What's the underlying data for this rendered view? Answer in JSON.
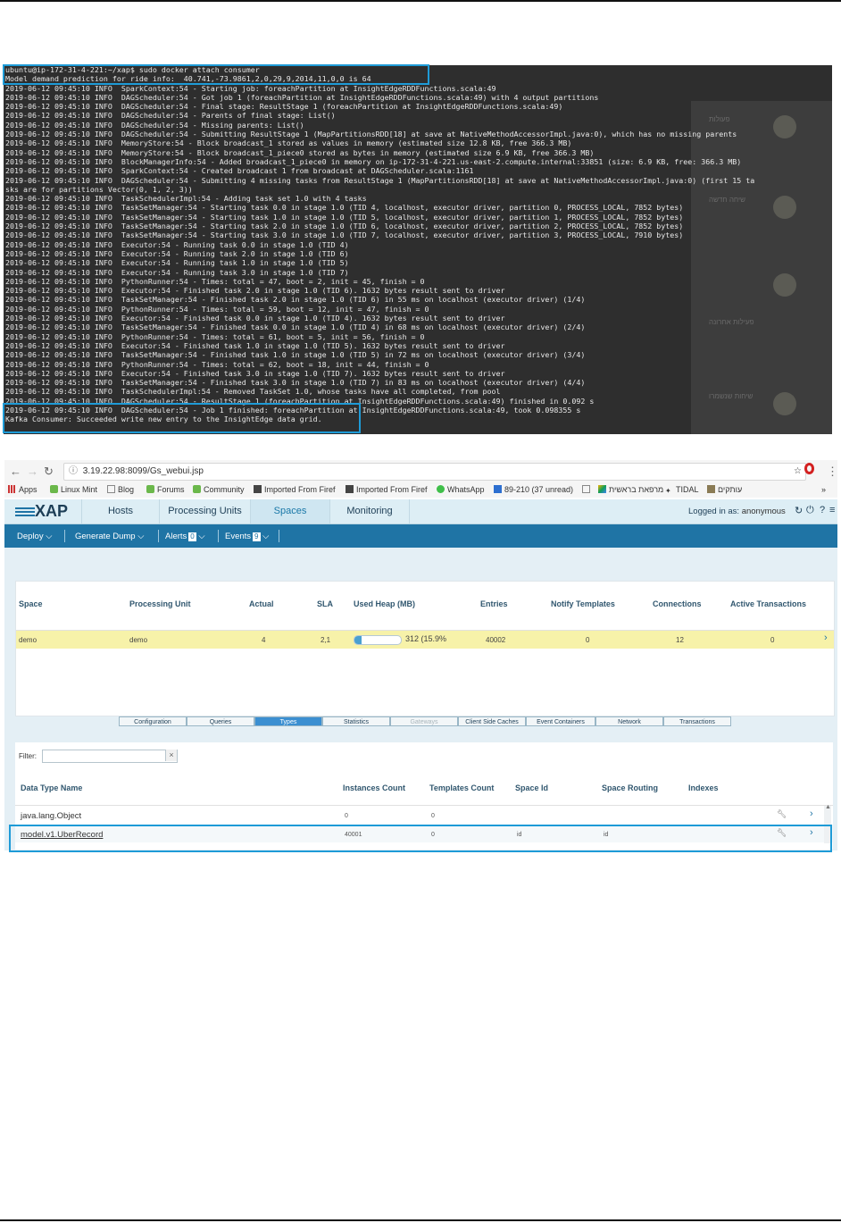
{
  "terminal": {
    "lines": [
      "ubuntu@ip-172-31-4-221:~/xap$ sudo docker attach consumer",
      "Model demand prediction for ride info:  40.741,-73.9861,2,0,29,9,2014,11,0,0 is 64",
      "2019-06-12 09:45:10 INFO  SparkContext:54 - Starting job: foreachPartition at InsightEdgeRDDFunctions.scala:49",
      "2019-06-12 09:45:10 INFO  DAGScheduler:54 - Got job 1 (foreachPartition at InsightEdgeRDDFunctions.scala:49) with 4 output partitions",
      "2019-06-12 09:45:10 INFO  DAGScheduler:54 - Final stage: ResultStage 1 (foreachPartition at InsightEdgeRDDFunctions.scala:49)",
      "2019-06-12 09:45:10 INFO  DAGScheduler:54 - Parents of final stage: List()",
      "2019-06-12 09:45:10 INFO  DAGScheduler:54 - Missing parents: List()",
      "2019-06-12 09:45:10 INFO  DAGScheduler:54 - Submitting ResultStage 1 (MapPartitionsRDD[18] at save at NativeMethodAccessorImpl.java:0), which has no missing parents",
      "2019-06-12 09:45:10 INFO  MemoryStore:54 - Block broadcast_1 stored as values in memory (estimated size 12.8 KB, free 366.3 MB)",
      "2019-06-12 09:45:10 INFO  MemoryStore:54 - Block broadcast_1_piece0 stored as bytes in memory (estimated size 6.9 KB, free 366.3 MB)",
      "2019-06-12 09:45:10 INFO  BlockManagerInfo:54 - Added broadcast_1_piece0 in memory on ip-172-31-4-221.us-east-2.compute.internal:33851 (size: 6.9 KB, free: 366.3 MB)",
      "2019-06-12 09:45:10 INFO  SparkContext:54 - Created broadcast 1 from broadcast at DAGScheduler.scala:1161",
      "2019-06-12 09:45:10 INFO  DAGScheduler:54 - Submitting 4 missing tasks from ResultStage 1 (MapPartitionsRDD[18] at save at NativeMethodAccessorImpl.java:0) (first 15 ta",
      "sks are for partitions Vector(0, 1, 2, 3))",
      "2019-06-12 09:45:10 INFO  TaskSchedulerImpl:54 - Adding task set 1.0 with 4 tasks",
      "2019-06-12 09:45:10 INFO  TaskSetManager:54 - Starting task 0.0 in stage 1.0 (TID 4, localhost, executor driver, partition 0, PROCESS_LOCAL, 7852 bytes)",
      "2019-06-12 09:45:10 INFO  TaskSetManager:54 - Starting task 1.0 in stage 1.0 (TID 5, localhost, executor driver, partition 1, PROCESS_LOCAL, 7852 bytes)",
      "2019-06-12 09:45:10 INFO  TaskSetManager:54 - Starting task 2.0 in stage 1.0 (TID 6, localhost, executor driver, partition 2, PROCESS_LOCAL, 7852 bytes)",
      "2019-06-12 09:45:10 INFO  TaskSetManager:54 - Starting task 3.0 in stage 1.0 (TID 7, localhost, executor driver, partition 3, PROCESS_LOCAL, 7910 bytes)",
      "2019-06-12 09:45:10 INFO  Executor:54 - Running task 0.0 in stage 1.0 (TID 4)",
      "2019-06-12 09:45:10 INFO  Executor:54 - Running task 2.0 in stage 1.0 (TID 6)",
      "2019-06-12 09:45:10 INFO  Executor:54 - Running task 1.0 in stage 1.0 (TID 5)",
      "2019-06-12 09:45:10 INFO  Executor:54 - Running task 3.0 in stage 1.0 (TID 7)",
      "2019-06-12 09:45:10 INFO  PythonRunner:54 - Times: total = 47, boot = 2, init = 45, finish = 0",
      "2019-06-12 09:45:10 INFO  Executor:54 - Finished task 2.0 in stage 1.0 (TID 6). 1632 bytes result sent to driver",
      "2019-06-12 09:45:10 INFO  TaskSetManager:54 - Finished task 2.0 in stage 1.0 (TID 6) in 55 ms on localhost (executor driver) (1/4)",
      "2019-06-12 09:45:10 INFO  PythonRunner:54 - Times: total = 59, boot = 12, init = 47, finish = 0",
      "2019-06-12 09:45:10 INFO  Executor:54 - Finished task 0.0 in stage 1.0 (TID 4). 1632 bytes result sent to driver",
      "2019-06-12 09:45:10 INFO  TaskSetManager:54 - Finished task 0.0 in stage 1.0 (TID 4) in 68 ms on localhost (executor driver) (2/4)",
      "2019-06-12 09:45:10 INFO  PythonRunner:54 - Times: total = 61, boot = 5, init = 56, finish = 0",
      "2019-06-12 09:45:10 INFO  Executor:54 - Finished task 1.0 in stage 1.0 (TID 5). 1632 bytes result sent to driver",
      "2019-06-12 09:45:10 INFO  TaskSetManager:54 - Finished task 1.0 in stage 1.0 (TID 5) in 72 ms on localhost (executor driver) (3/4)",
      "2019-06-12 09:45:10 INFO  PythonRunner:54 - Times: total = 62, boot = 18, init = 44, finish = 0",
      "2019-06-12 09:45:10 INFO  Executor:54 - Finished task 3.0 in stage 1.0 (TID 7). 1632 bytes result sent to driver",
      "2019-06-12 09:45:10 INFO  TaskSetManager:54 - Finished task 3.0 in stage 1.0 (TID 7) in 83 ms on localhost (executor driver) (4/4)",
      "2019-06-12 09:45:10 INFO  TaskSchedulerImpl:54 - Removed TaskSet 1.0, whose tasks have all completed, from pool",
      "2019-06-12 09:45:10 INFO  DAGScheduler:54 - ResultStage 1 (foreachPartition at InsightEdgeRDDFunctions.scala:49) finished in 0.092 s",
      "2019-06-12 09:45:10 INFO  DAGScheduler:54 - Job 1 finished: foreachPartition at InsightEdgeRDDFunctions.scala:49, took 0.098355 s",
      "Kafka Consumer: Succeeded write new entry to the InsightEdge data grid."
    ],
    "background_notifications": [
      "פעולות",
      "שיחה חדשה",
      "פעילות אחרונה",
      "שיחות שנשמרו"
    ]
  },
  "browser": {
    "url": "3.19.22.98:8099/Gs_webui.jsp",
    "bookmarks": [
      "Apps",
      "Linux Mint",
      "Blog",
      "Forums",
      "Community",
      "Imported From Firef",
      "Imported From Firef",
      "WhatsApp",
      "89-210 (37 unread)",
      "מרפאת בראשית",
      "TIDAL",
      "עותקים"
    ],
    "more_bookmarks": "»"
  },
  "xap": {
    "logo": "XAP",
    "tabs": [
      "Hosts",
      "Processing Units",
      "Spaces",
      "Monitoring"
    ],
    "active_tab": "Spaces",
    "logged_in_label": "Logged in as:",
    "logged_in_user": "anonymous",
    "toolbar": {
      "deploy": "Deploy",
      "generate_dump": "Generate Dump",
      "alerts": "Alerts",
      "alerts_count": "0",
      "events": "Events",
      "events_count": "9"
    },
    "spaces_table": {
      "headers": [
        "Space",
        "Processing Unit",
        "Actual",
        "SLA",
        "Used Heap (MB)",
        "Entries",
        "Notify Templates",
        "Connections",
        "Active Transactions"
      ],
      "rows": [
        {
          "space": "demo",
          "processing_unit": "demo",
          "actual": "4",
          "sla": "2,1",
          "heap": "312 (15.9%",
          "heap_fraction": 0.159,
          "entries": "40002",
          "notify_templates": "0",
          "connections": "12",
          "active_transactions": "0"
        }
      ]
    },
    "detail_tabs": [
      "Configuration",
      "Queries",
      "Types",
      "Statistics",
      "Gateways",
      "Client Side Caches",
      "Event Containers",
      "Network",
      "Transactions"
    ],
    "active_detail_tab": "Types",
    "filter_label": "Filter:",
    "types_table": {
      "headers": [
        "Data Type Name",
        "Instances Count",
        "Templates Count",
        "Space Id",
        "Space Routing",
        "Indexes"
      ],
      "rows": [
        {
          "name": "java.lang.Object",
          "instances": "0",
          "templates": "0",
          "space_id": "",
          "space_routing": ""
        },
        {
          "name": "model.v1.UberRecord",
          "instances": "40001",
          "templates": "0",
          "space_id": "id",
          "space_routing": "id"
        }
      ]
    }
  }
}
